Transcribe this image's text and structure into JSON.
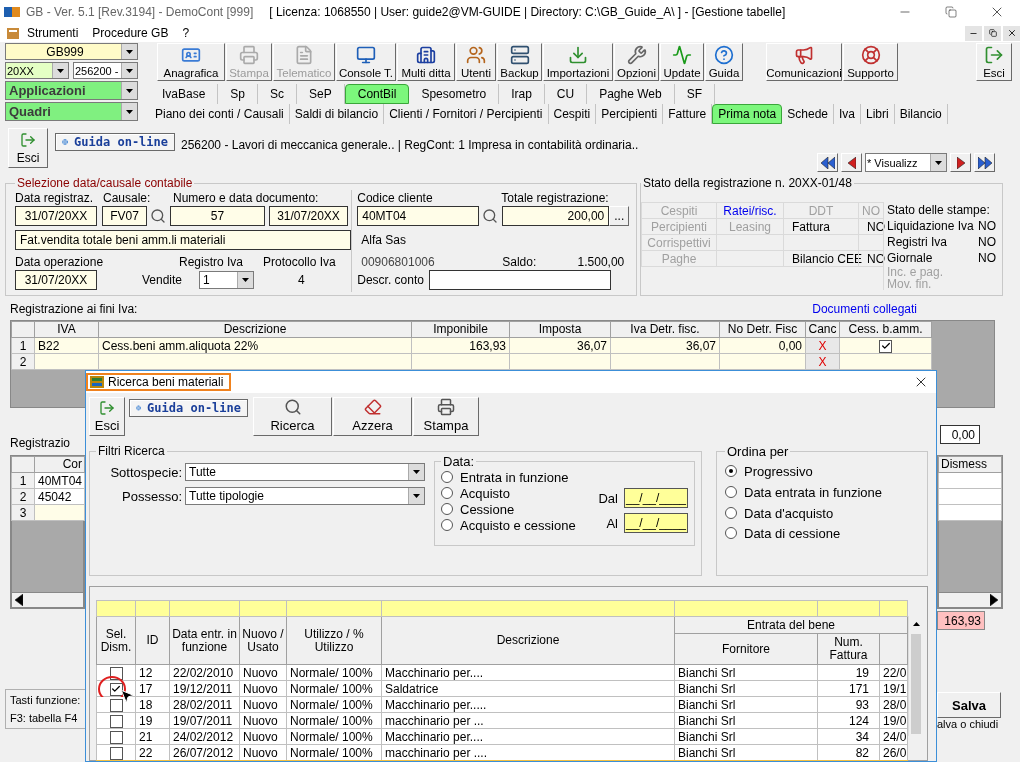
{
  "window": {
    "title": "GB - Ver. 5.1 [Rev.3194] -  DemoCont [999]",
    "context": "[ Licenza: 1068550 | User: guide2@VM-GUIDE | Directory: C:\\GB_Guide_A\\ ] - [Gestione tabelle]"
  },
  "menu": [
    "Strumenti",
    "Procedure GB",
    "?"
  ],
  "selectors": {
    "company": "GB999",
    "year": "20XX",
    "activity": "256200 -",
    "applications": "Applicazioni",
    "panels": "Quadri"
  },
  "toolbar": [
    {
      "label": "Anagrafica",
      "disabled": false
    },
    {
      "label": "Stampa",
      "disabled": true
    },
    {
      "label": "Telematico",
      "disabled": true
    },
    {
      "label": "Console T.",
      "disabled": false
    },
    {
      "label": "Multi ditta",
      "disabled": false
    },
    {
      "label": "Utenti",
      "disabled": false
    },
    {
      "label": "Backup",
      "disabled": false
    },
    {
      "label": "Importazioni",
      "disabled": false
    },
    {
      "label": "Opzioni",
      "disabled": false
    },
    {
      "label": "Update",
      "disabled": false
    },
    {
      "label": "Guida",
      "disabled": false
    }
  ],
  "toolbar_right": [
    "Comunicazioni",
    "Supporto"
  ],
  "exit": "Esci",
  "module_tabs": [
    {
      "label": "IvaBase",
      "selected": false
    },
    {
      "label": "Sp",
      "selected": false
    },
    {
      "label": "Sc",
      "selected": false
    },
    {
      "label": "SeP",
      "selected": false
    },
    {
      "label": "ContBil",
      "selected": true
    },
    {
      "label": "Spesometro",
      "selected": false
    },
    {
      "label": "Irap",
      "selected": false
    },
    {
      "label": "CU",
      "selected": false
    },
    {
      "label": "Paghe Web",
      "selected": false
    },
    {
      "label": "SF",
      "selected": false
    }
  ],
  "section_tabs": [
    {
      "label": "Piano dei conti / Causali",
      "selected": false
    },
    {
      "label": "Saldi di bilancio",
      "selected": false
    },
    {
      "label": "Clienti / Fornitori / Percipienti",
      "selected": false
    },
    {
      "label": "Cespiti",
      "selected": false
    },
    {
      "label": "Percipienti",
      "selected": false
    },
    {
      "label": "Fatture",
      "selected": false
    },
    {
      "label": "Prima nota",
      "selected": true
    },
    {
      "label": "Schede",
      "selected": false
    },
    {
      "label": "Iva",
      "selected": false
    },
    {
      "label": "Libri",
      "selected": false
    },
    {
      "label": "Bilancio",
      "selected": false
    }
  ],
  "document": {
    "exit": "Esci",
    "help": "Guida on-line",
    "info": "256200 - Lavori di meccanica generale.. | RegCont: 1 Impresa  in contabilità ordinaria.."
  },
  "navigator": {
    "mode": "* Visualizz"
  },
  "selection": {
    "title": "Selezione data/causale contabile",
    "date_label": "Data registraz.",
    "date": "31/07/20XX",
    "causale_label": "Causale:",
    "causale": "FV07",
    "doc_label": "Numero e data documento:",
    "doc_number": "57",
    "doc_date": "31/07/20XX",
    "description": "Fat.vendita totale beni amm.li materiali",
    "op_date_label": "Data operazione",
    "op_date": "31/07/20XX",
    "register_label": "Registro Iva",
    "register": "Vendite",
    "register_number": "1",
    "protocol_label": "Protocollo Iva",
    "protocol": "4",
    "customer_label": "Codice cliente",
    "customer": "40MT04",
    "total_label": "Totale registrazione:",
    "total": "200,00",
    "more": "...",
    "customer_name": "Alfa Sas",
    "vat_number": "00906801006",
    "balance_label": "Saldo:",
    "balance": "1.500,00",
    "account_label": "Descr. conto"
  },
  "status": {
    "title": "Stato della registrazione n. 20XX-01/48",
    "grid": [
      [
        {
          "text": "Cespiti",
          "kind": "disabled"
        },
        {
          "text": "Ratei/risc.",
          "kind": "link"
        },
        {
          "text": "DDT",
          "kind": "disabled"
        },
        {
          "text": "NO",
          "kind": "disabled"
        }
      ],
      [
        {
          "text": "Percipienti",
          "kind": "disabled"
        },
        {
          "text": "Leasing",
          "kind": "disabled"
        },
        {
          "text": "Fattura",
          "kind": "normal"
        },
        {
          "text": "NO",
          "kind": "normal"
        }
      ],
      [
        {
          "text": "Corrispettivi",
          "kind": "disabled"
        },
        {
          "kind": "empty"
        },
        {
          "kind": "empty"
        },
        {
          "kind": "empty"
        }
      ],
      [
        {
          "text": "Paghe",
          "kind": "disabled"
        },
        {
          "kind": "empty"
        },
        {
          "text": "Bilancio CEE",
          "kind": "normal"
        },
        {
          "text": "NO",
          "kind": "normal"
        }
      ]
    ],
    "prints_title": "Stato delle stampe:",
    "prints": [
      {
        "label": "Liquidazione Iva",
        "value": "NO",
        "disabled": false
      },
      {
        "label": "Registri Iva",
        "value": "NO",
        "disabled": false
      },
      {
        "label": "Giornale",
        "value": "NO",
        "disabled": false
      },
      {
        "label": "Inc. e pag.",
        "disabled": true
      },
      {
        "label": "Mov. fin.",
        "disabled": true
      }
    ]
  },
  "vat": {
    "title": "Registrazione ai fini Iva:",
    "link": "Documenti collegati",
    "columns": [
      "IVA",
      "Descrizione",
      "Imponibile",
      "Imposta",
      "Iva Detr. fisc.",
      "No Detr. Fisc",
      "Canc",
      "Cess. b.amm."
    ],
    "rows": [
      {
        "num": "1",
        "cells": [
          "B22",
          "Cess.beni amm.aliquota 22%",
          "163,93",
          "36,07",
          "36,07",
          "0,00"
        ],
        "cancel": "X",
        "checked": true
      },
      {
        "num": "2",
        "cancel": "X"
      }
    ]
  },
  "entries": {
    "title": "Registrazio",
    "column": "Cor",
    "rows": [
      {
        "num": "1",
        "value": "40MT04"
      },
      {
        "num": "2",
        "value": "45042"
      },
      {
        "num": "3"
      }
    ],
    "amount": "0,00",
    "side_column": "Dismess",
    "total": "163,93",
    "save": "Salva",
    "save_hint": "alva o chiudi",
    "keys_title": "Tasti funzione:",
    "keys": "F3: tabella F4"
  },
  "dialog": {
    "title": "Ricerca beni materiali",
    "exit": "Esci",
    "help": "Guida on-line",
    "actions": [
      "Ricerca",
      "Azzera",
      "Stampa"
    ],
    "filters": {
      "title": "Filtri Ricerca",
      "fields": [
        {
          "label": "Sottospecie:",
          "value": "Tutte"
        },
        {
          "label": "Possesso:",
          "value": "Tutte tipologie"
        }
      ],
      "date": {
        "title": "Data:",
        "options": [
          {
            "label": "Entrata in funzione",
            "selected": false
          },
          {
            "label": "Acquisto",
            "selected": false
          },
          {
            "label": "Cessione",
            "selected": false
          },
          {
            "label": "Acquisto e cessione",
            "selected": false
          }
        ],
        "from_label": "Dal",
        "from": "__/__/____",
        "to_label": "Al",
        "to": "__/__/____"
      }
    },
    "order": {
      "title": "Ordina per",
      "options": [
        {
          "label": "Progressivo",
          "selected": true
        },
        {
          "label": "Data entrata in funzione",
          "selected": false
        },
        {
          "label": "Data d'acquisto",
          "selected": false
        },
        {
          "label": "Data di cessione",
          "selected": false
        }
      ]
    },
    "results": {
      "select_column": "Sel. Dism.",
      "columns": [
        "ID",
        "Data entr. in funzione",
        "Nuovo / Usato",
        "Utilizzo / % Utilizzo",
        "Descrizione"
      ],
      "group": "Entrata del bene",
      "group_columns": [
        "Fornitore",
        "Num. Fattura"
      ],
      "rows": [
        {
          "checked": false,
          "highlighted": false,
          "cells": [
            "12",
            "22/02/2010",
            "Nuovo",
            "Normale/ 100%",
            "Macchinario per....",
            "Bianchi Srl",
            "19",
            "22/0"
          ]
        },
        {
          "checked": true,
          "highlighted": true,
          "cells": [
            "17",
            "19/12/2011",
            "Nuovo",
            "Normale/ 100%",
            "Saldatrice",
            "Bianchi Srl",
            "171",
            "19/1"
          ]
        },
        {
          "checked": false,
          "highlighted": false,
          "cells": [
            "18",
            "28/02/2011",
            "Nuovo",
            "Normale/ 100%",
            "Macchinario per.....",
            "Bianchi Srl",
            "93",
            "28/0"
          ]
        },
        {
          "checked": false,
          "highlighted": false,
          "cells": [
            "19",
            "19/07/2011",
            "Nuovo",
            "Normale/ 100%",
            "macchinario per ...",
            "Bianchi Srl",
            "124",
            "19/0"
          ]
        },
        {
          "checked": false,
          "highlighted": false,
          "cells": [
            "21",
            "24/02/2012",
            "Nuovo",
            "Normale/ 100%",
            "Macchinario per....",
            "Bianchi Srl",
            "34",
            "24/0"
          ]
        },
        {
          "checked": false,
          "highlighted": false,
          "cells": [
            "22",
            "26/07/2012",
            "Nuovo",
            "Normale/ 100%",
            "macchinario per ....",
            "Bianchi Srl",
            "82",
            "26/0"
          ]
        }
      ]
    }
  }
}
